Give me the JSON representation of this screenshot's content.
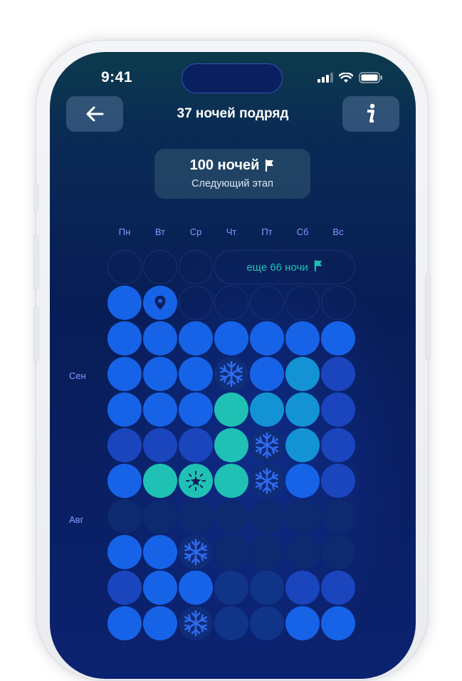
{
  "status_bar": {
    "time": "9:41"
  },
  "header": {
    "title": "37 ночей подряд",
    "back_icon": "arrow-left-icon",
    "info_icon": "info-icon"
  },
  "milestone": {
    "title": "100 ночей",
    "subtitle": "Следующий этап"
  },
  "calendar": {
    "weekdays": [
      "Пн",
      "Вт",
      "Ср",
      "Чт",
      "Пт",
      "Сб",
      "Вс"
    ],
    "months": [
      "Сен",
      "Авг"
    ],
    "remaining_label": "еще 66 ночи",
    "rows": [
      [
        "empty",
        "empty",
        "empty",
        "remaining",
        "remaining",
        "remaining",
        "remaining"
      ],
      [
        "blue",
        "pin",
        "empty",
        "empty",
        "empty",
        "empty",
        "empty"
      ],
      [
        "blue",
        "blue",
        "blue",
        "blue",
        "blue",
        "blue",
        "blue"
      ],
      [
        "blue",
        "blue",
        "blue",
        "snow",
        "blue",
        "cyan",
        "mid"
      ],
      [
        "blue",
        "blue",
        "blue",
        "teal",
        "cyan",
        "cyan",
        "mid"
      ],
      [
        "mid",
        "mid",
        "mid",
        "teal",
        "snow",
        "cyan",
        "mid"
      ],
      [
        "blue",
        "teal",
        "star",
        "teal",
        "snow",
        "blue",
        "mid"
      ],
      [
        "faint",
        "faint",
        "faint",
        "faint",
        "faint",
        "faint",
        "faint"
      ],
      [
        "blue",
        "blue",
        "snow",
        "faint",
        "faint",
        "faint",
        "faint"
      ],
      [
        "mid",
        "blue",
        "blue",
        "dark",
        "dark",
        "mid",
        "mid"
      ],
      [
        "blue",
        "blue",
        "snow",
        "dark",
        "dark",
        "blue",
        "blue"
      ]
    ]
  },
  "colors": {
    "teal": "#1fc1b4",
    "accent_blue": "#1763e8",
    "label": "#7f9dff"
  }
}
